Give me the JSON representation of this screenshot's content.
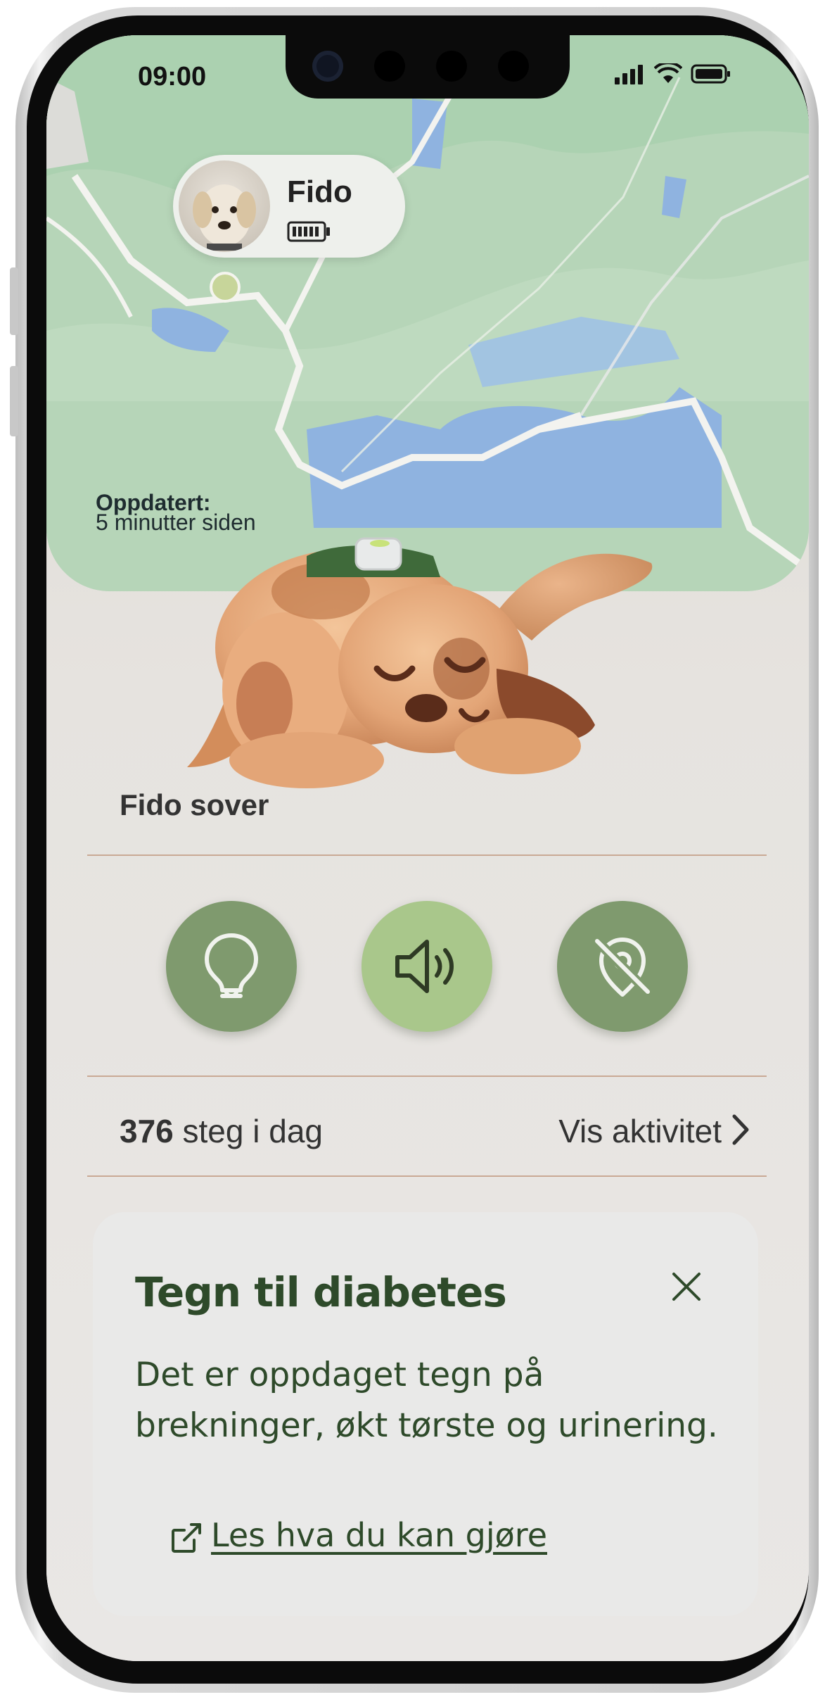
{
  "status_bar": {
    "time": "09:00"
  },
  "pet": {
    "name": "Fido"
  },
  "map": {
    "updated_label": "Oppdatert:",
    "updated_value": "5 minutter siden"
  },
  "state": {
    "status_text": "Fido sover"
  },
  "actions": [
    {
      "name": "light-button",
      "icon": "lightbulb-icon",
      "color": "#7f9a6e"
    },
    {
      "name": "sound-button",
      "icon": "speaker-icon",
      "color": "#a9c78b"
    },
    {
      "name": "tracking-off-button",
      "icon": "location-off-icon",
      "color": "#7f9a6e"
    }
  ],
  "activity": {
    "steps_value": "376",
    "steps_suffix": " steg i dag",
    "link_label": "Vis aktivitet"
  },
  "alert_card": {
    "title": "Tegn til diabetes",
    "body": "Det er oppdaget tegn på brekninger, økt tørste og urinering.",
    "link_label": "Les hva du kan gjøre"
  },
  "colors": {
    "accent_green": "#2e4a2a",
    "button_green": "#7f9a6e",
    "button_light": "#a9c78b",
    "divider": "#c9a995"
  }
}
